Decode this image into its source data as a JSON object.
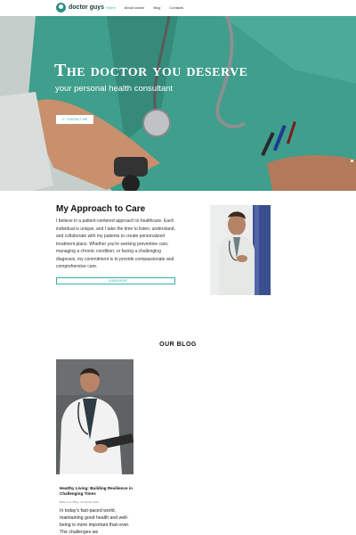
{
  "brand": {
    "name": "doctor guys"
  },
  "nav": {
    "items": [
      {
        "label": "Home",
        "active": true
      },
      {
        "label": "About doctor",
        "active": false
      },
      {
        "label": "Blog",
        "active": false
      },
      {
        "label": "Contacts",
        "active": false
      }
    ]
  },
  "hero": {
    "title": "The doctor you deserve",
    "subtitle": "your personal health consultant",
    "cta_label": "CONTACT ME"
  },
  "approach": {
    "title": "My Approach to Care",
    "body": "I believe in a patient-centered approach to healthcare. Each individual is unique, and I take the time to listen, understand, and collaborate with my patients to create personalized treatment plans. Whether you're seeking preventive care, managing a chronic condition, or facing a challenging diagnosis, my commitment is to provide compassionate and comprehensive care.",
    "button_label": "LEARN MORE"
  },
  "blog": {
    "heading": "OUR BLOG",
    "posts": [
      {
        "title": "Healthy Living: Building Resilience in Challenging Times",
        "author": "Bella Cruz",
        "category": "Blog",
        "date": "10 October 2023",
        "excerpt": "In today's fast-paced world, maintaining good health and well-being is more important than ever. The challenges we"
      }
    ]
  },
  "colors": {
    "accent": "#34b3a8",
    "scrubs": "#3f9e8c",
    "logo": "#2f8f86"
  }
}
